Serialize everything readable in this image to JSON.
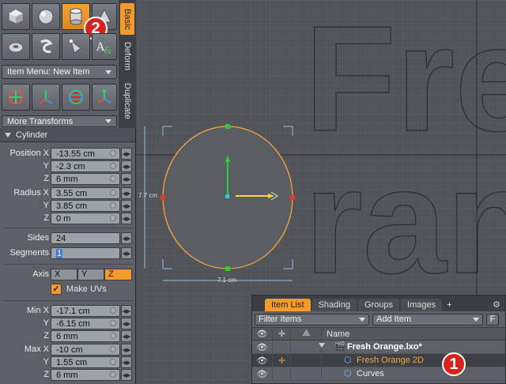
{
  "toolbox": {
    "tools_row1": [
      {
        "icon": "cube-icon",
        "active": false
      },
      {
        "icon": "sphere-icon",
        "active": false
      },
      {
        "icon": "cylinder-icon",
        "active": true
      },
      {
        "icon": "cone-icon",
        "active": false
      }
    ],
    "tools_row2": [
      {
        "icon": "torus-icon",
        "active": false
      },
      {
        "icon": "capsule-icon",
        "active": false
      },
      {
        "icon": "bezier-icon",
        "active": false
      },
      {
        "icon": "text-icon",
        "active": false
      }
    ],
    "item_menu_label": "Item Menu: New Item",
    "transform_tools": [
      "transform-icon",
      "move-icon",
      "rotate-icon",
      "scale-icon"
    ],
    "more_transforms_label": "More Transforms",
    "vertical_tabs": [
      "Basic",
      "Deform",
      "Duplicate"
    ],
    "badge_2": "2"
  },
  "properties": {
    "title": "Cylinder",
    "position_label": "Position X",
    "position": {
      "x": "-13.55 cm",
      "y": "-2.3 cm",
      "z": "6 mm"
    },
    "radius_label": "Radius X",
    "radius": {
      "x": "3.55 cm",
      "y": "3.85 cm",
      "z": "0 m"
    },
    "sides_label": "Sides",
    "sides": "24",
    "segments_label": "Segments",
    "segments": "1",
    "axis_label": "Axis",
    "axis_options": [
      "X",
      "Y",
      "Z"
    ],
    "axis_selected": "Z",
    "make_uvs_label": "Make UVs",
    "min_label": "Min X",
    "min": {
      "x": "-17.1 cm",
      "y": "-6.15 cm",
      "z": "6 mm"
    },
    "max_label": "Max X",
    "max": {
      "x": "-10 cm",
      "y": "1.55 cm",
      "z": "6 mm"
    },
    "y_label": "Y",
    "z_label": "Z"
  },
  "viewport": {
    "dim_height": "7.7 cm",
    "dim_width": "7.1 cm",
    "text_line1": "Fre",
    "text_line2": "ran"
  },
  "item_list": {
    "tabs": [
      "Item List",
      "Shading",
      "Groups",
      "Images"
    ],
    "active_tab": "Item List",
    "add_tab": "+",
    "filter_label": "Filter Items",
    "add_item_label": "Add Item",
    "f_button": "F",
    "column_name": "Name",
    "items": [
      {
        "name": "Fresh Orange.lxo*",
        "bold": true,
        "selected": false,
        "icon": "scene-icon"
      },
      {
        "name": "Fresh Orange 2D",
        "bold": false,
        "selected": true,
        "icon": "mesh-icon"
      },
      {
        "name": "Curves",
        "bold": false,
        "selected": false,
        "icon": "mesh-icon"
      }
    ],
    "badge_1": "1"
  },
  "colors": {
    "accent": "#f39b2c",
    "selection_orange": "#f7a23a",
    "badge_red": "#d6241c"
  }
}
